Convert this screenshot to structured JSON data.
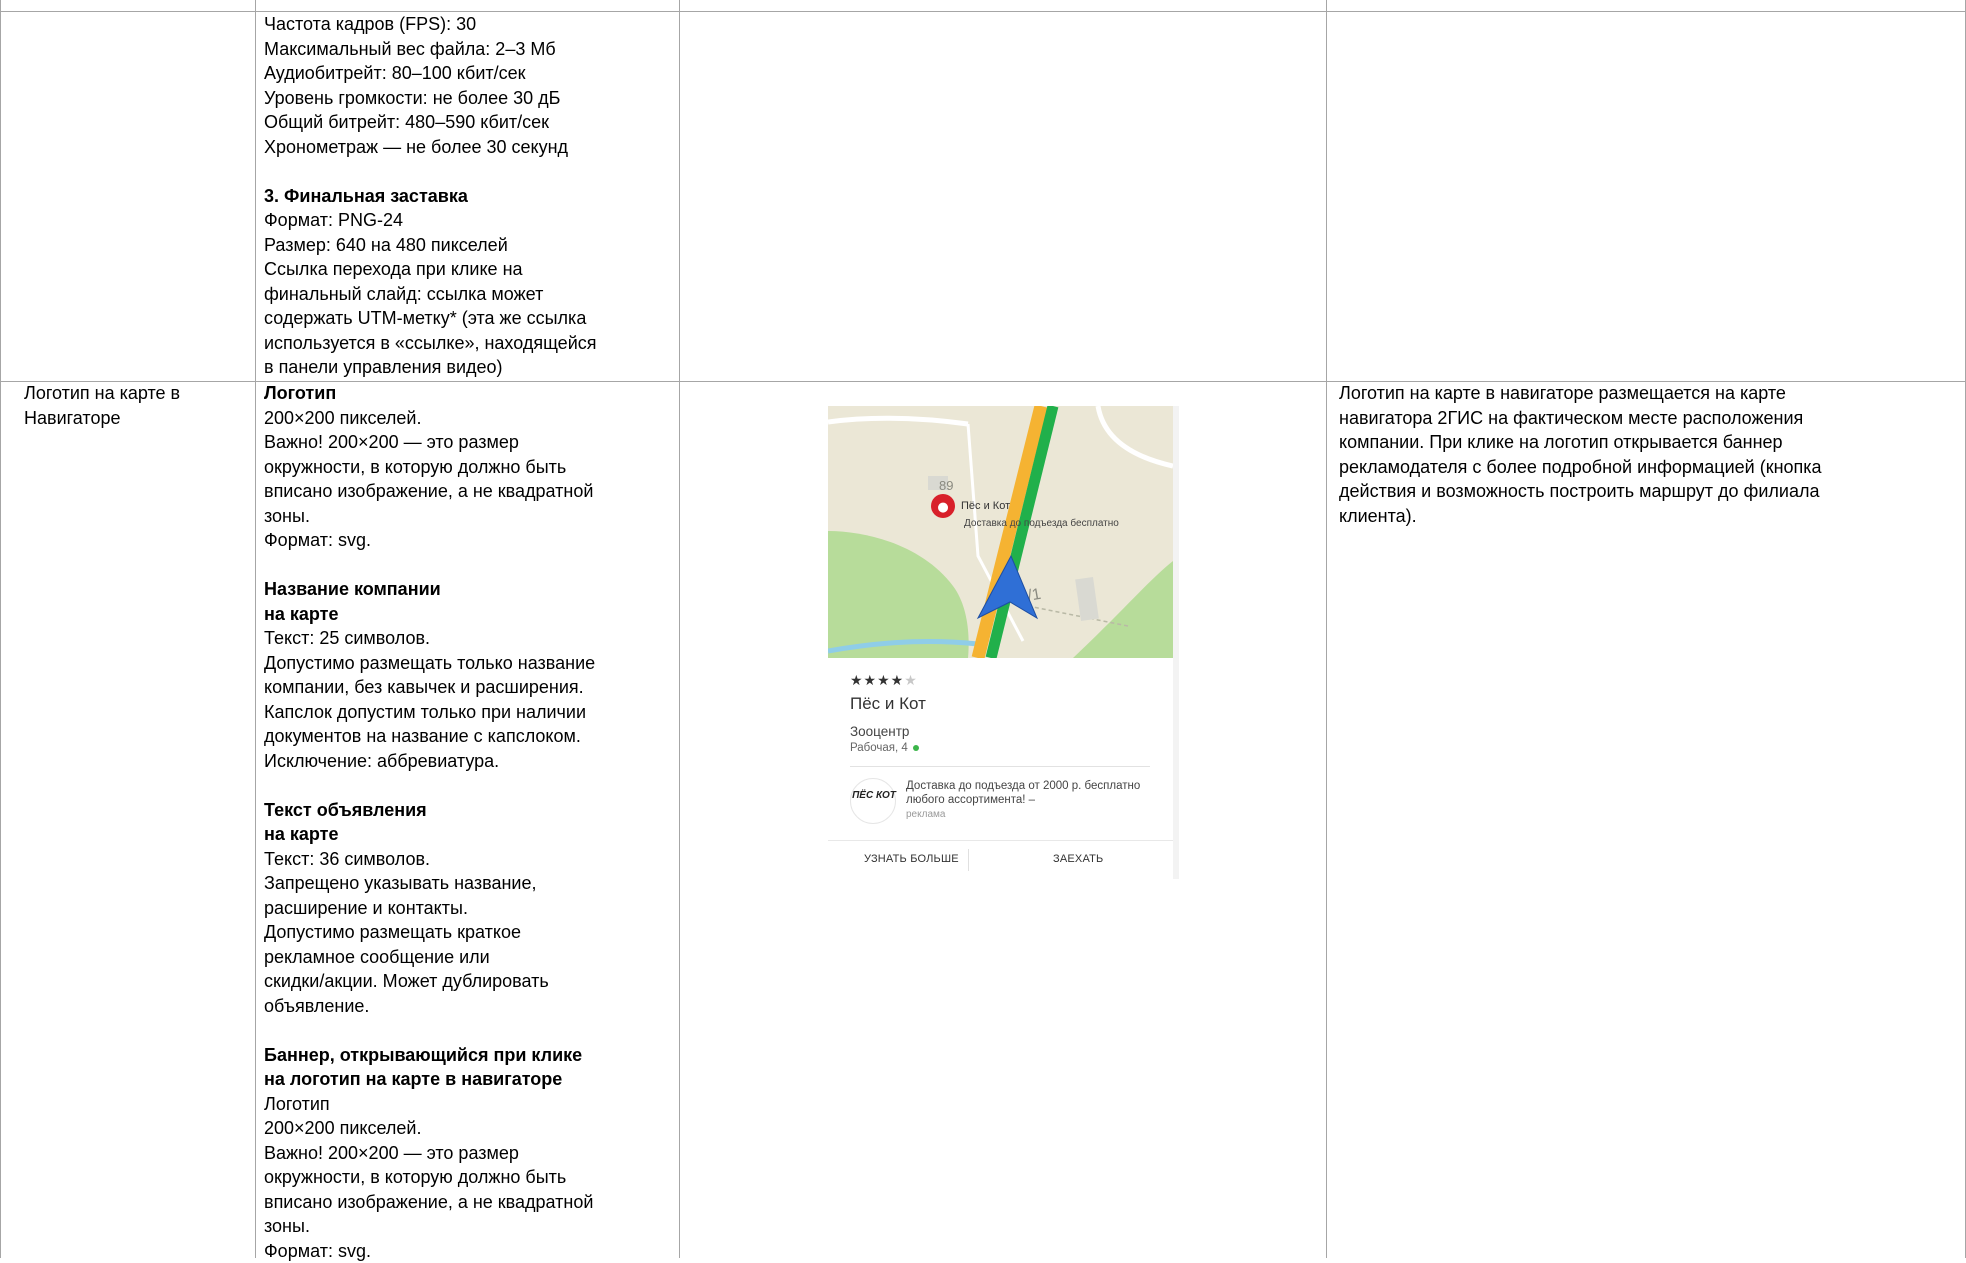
{
  "row1": {
    "specs": [
      "Частота кадров (FPS): 30",
      "Максимальный вес файла: 2–3 Мб",
      "Аудиобитрейт: 80–100 кбит/сек",
      "Уровень громкости: не более 30 дБ",
      "Общий битрейт: 480–590 кбит/сек",
      "Хронометраж — не более 30 секунд"
    ],
    "final_title": "3. Финальная заставка",
    "final_lines": [
      "Формат: PNG-24",
      "Размер: 640 на 480 пикселей",
      "Ссылка перехода при клике на",
      "финальный слайд: ссылка может",
      "содержать UTM-метку* (эта же ссылка",
      "используется в «ссылке», находящейся",
      "в панели управления видео)"
    ]
  },
  "row2": {
    "name_lines": [
      "Логотип на карте в",
      "Навигаторе"
    ],
    "logo": {
      "title": "Логотип",
      "lines": [
        "200×200 пикселей.",
        "Важно! 200×200 — это размер",
        "окружности, в которую должно быть",
        "вписано изображение, а не квадратной",
        "зоны.",
        "Формат: svg."
      ]
    },
    "company": {
      "title_lines": [
        "Название компании",
        "на карте"
      ],
      "lines": [
        "Текст: 25 символов.",
        "Допустимо размещать только название",
        "компании, без кавычек и расширения.",
        "Капслок допустим только при наличии",
        "документов на название с капслоком.",
        "Исключение: аббревиатура."
      ]
    },
    "adtext": {
      "title_lines": [
        "Текст объявления",
        "на карте"
      ],
      "lines": [
        "Текст: 36 символов.",
        "Запрещено указывать название,",
        "расширение и контакты.",
        "Допустимо размещать краткое",
        "рекламное сообщение или",
        "скидки/акции. Может дублировать",
        "объявление."
      ]
    },
    "banner": {
      "title_lines": [
        "Баннер, открывающийся при клике",
        "на логотип на карте в навигаторе"
      ],
      "lines": [
        "Логотип",
        "200×200 пикселей.",
        "Важно! 200×200 — это размер",
        "окружности, в которую должно быть",
        "вписано изображение, а не квадратной",
        "зоны.",
        "Формат: svg."
      ]
    },
    "description_lines": [
      "Логотип на карте в навигаторе размещается на карте",
      "навигатора 2ГИС на фактическом месте расположения",
      "компании. При клике на логотип открывается баннер",
      "рекламодателя с более подробной информацией (кнопка",
      "действия и возможность построить маршрут до филиала",
      "клиента)."
    ]
  },
  "screenshot": {
    "map": {
      "house_number": "89",
      "pin_label": "Пёс и Кот",
      "pin_sublabel": "Доставка до подъезда бесплатно",
      "building_number": "34/1"
    },
    "card": {
      "stars_on": "★★★★",
      "stars_off": "★",
      "rating": 4,
      "name": "Пёс и Кот",
      "category": "Зооцентр",
      "address": "Рабочая, 4",
      "logo_text": "ПЁС КОТ",
      "ad_text": "Доставка до подъезда от 2000 р. бесплатно любого ассортимента! –",
      "ad_tag": "реклама",
      "btn_more": "УЗНАТЬ БОЛЬШЕ",
      "btn_visit": "ЗАЕХАТЬ"
    },
    "colors": {
      "map_bg": "#ebe7d6",
      "park": "#b7dc9a",
      "route": "#21b04b",
      "road": "#f5b332",
      "river": "#8fcde8",
      "arrow": "#2f6fd6",
      "pin": "#d8202a"
    }
  }
}
